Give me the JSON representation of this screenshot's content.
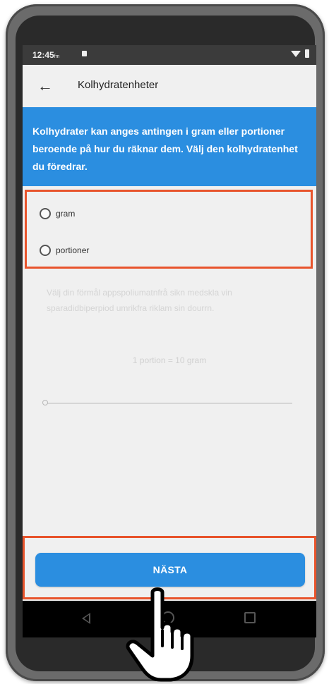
{
  "status_bar": {
    "time": "12:45",
    "time_suffix": "fm"
  },
  "toolbar": {
    "back_icon": "arrow-left-icon",
    "title": "Kolhydratenheter"
  },
  "info_banner": {
    "text": "Kolhydrater kan anges antingen i gram eller portioner beroende på hur du räknar dem. Välj den kolhydratenhet du föredrar."
  },
  "unit_options": [
    {
      "label": "gram",
      "selected": false
    },
    {
      "label": "portioner",
      "selected": false
    }
  ],
  "faded_section": {
    "description": "Välj din förmål appspoliumatnfrå sikn medskla vin sparadidbiperpiod umrikfra riklam sin dourrn.",
    "value_text": "1 portion = 10 gram"
  },
  "slider": {
    "value": 0
  },
  "next_button": {
    "label": "NÄSTA"
  },
  "nav_bar": {
    "back_icon": "nav-back-icon",
    "home_icon": "nav-home-icon",
    "recent_icon": "nav-recent-apps-icon"
  },
  "colors": {
    "accent": "#2b8ee0",
    "highlight": "#e8542c",
    "screen_bg": "#f0f0f0"
  }
}
